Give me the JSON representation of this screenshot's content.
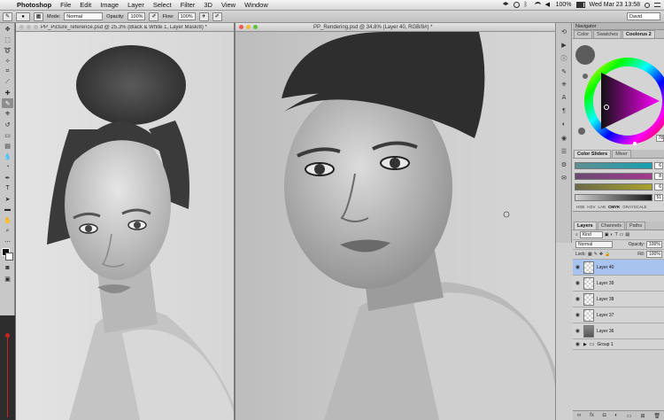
{
  "menubar": {
    "app": "Photoshop",
    "items": [
      "File",
      "Edit",
      "Image",
      "Layer",
      "Select",
      "Filter",
      "3D",
      "View",
      "Window"
    ],
    "clock": "Wed Mar 23  13:58",
    "battery": "100%"
  },
  "options": {
    "mode_label": "Mode:",
    "mode_value": "Normal",
    "opacity_label": "Opacity:",
    "opacity_value": "100%",
    "flow_label": "Flow:",
    "flow_value": "100%",
    "workspace": "David"
  },
  "documents": {
    "left_title": "PP_Picture_reference.psd @ 25.3% (Black & White 1, Layer Mask/8) *",
    "right_title": "PP_Rendering.psd @ 34.8% (Layer 40, RGB/8#) *"
  },
  "panel": {
    "navigator": "Navigator",
    "color_tabs": [
      "Color",
      "Swatches",
      "Coolorus 2"
    ],
    "sliders_tabs": [
      "Color Sliders",
      "Mixer"
    ],
    "slider_values": [
      "6",
      "8",
      "6",
      "51"
    ],
    "modes": [
      "HSB",
      "HSV",
      "LAB",
      "CMYK",
      "GRAYSCALE"
    ],
    "active_mode": "CMYK",
    "brush_size": "78",
    "layers_tabs": [
      "Layers",
      "Channels",
      "Paths"
    ],
    "kind_label": "Kind",
    "blend_mode": "Normal",
    "opacity_label": "Opacity:",
    "opacity_value": "100%",
    "lock_label": "Lock:",
    "fill_label": "Fill:",
    "fill_value": "100%",
    "layers": [
      {
        "name": "Layer 40",
        "selected": true
      },
      {
        "name": "Layer 39",
        "selected": false
      },
      {
        "name": "Layer 38",
        "selected": false
      },
      {
        "name": "Layer 37",
        "selected": false
      },
      {
        "name": "Layer 36",
        "selected": false
      },
      {
        "name": "Group 1",
        "selected": false
      }
    ]
  }
}
